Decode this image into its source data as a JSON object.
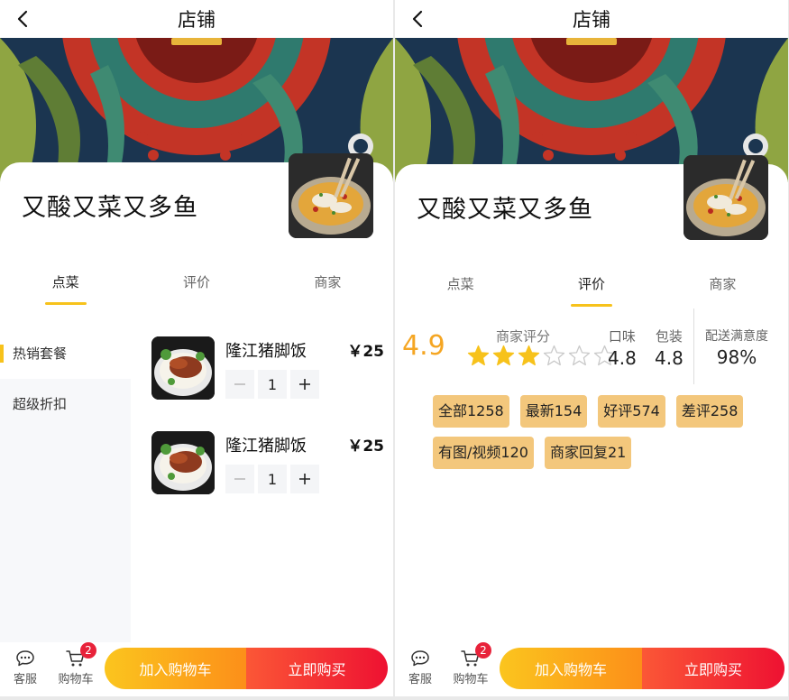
{
  "left": {
    "nav": {
      "title": "店铺"
    },
    "shop": {
      "name": "又酸又菜又多鱼"
    },
    "tabs": [
      {
        "label": "点菜",
        "active": true
      },
      {
        "label": "评价",
        "active": false
      },
      {
        "label": "商家",
        "active": false
      }
    ],
    "categories": [
      {
        "label": "热销套餐",
        "active": true
      },
      {
        "label": "超级折扣",
        "active": false
      }
    ],
    "dishes": [
      {
        "name": "隆江猪脚饭",
        "price": "￥25",
        "quantity": "1"
      },
      {
        "name": "隆江猪脚饭",
        "price": "￥25",
        "quantity": "1"
      }
    ],
    "bottom": {
      "service_label": "客服",
      "cart_label": "购物车",
      "cart_badge": "2",
      "add_to_cart": "加入购物车",
      "buy_now": "立即购买"
    }
  },
  "right": {
    "nav": {
      "title": "店铺"
    },
    "shop": {
      "name": "又酸又菜又多鱼"
    },
    "tabs": [
      {
        "label": "点菜",
        "active": false
      },
      {
        "label": "评价",
        "active": true
      },
      {
        "label": "商家",
        "active": false
      }
    ],
    "rating": {
      "score": "4.9",
      "title": "商家评分",
      "stars_filled": 3,
      "stars_total": 6,
      "taste_label": "口味",
      "taste_value": "4.8",
      "packaging_label": "包装",
      "packaging_value": "4.8",
      "delivery_label": "配送满意度",
      "delivery_value": "98%"
    },
    "filters": [
      "全部1258",
      "最新154",
      "好评574",
      "差评258",
      "有图/视频120",
      "商家回复21"
    ],
    "bottom": {
      "service_label": "客服",
      "cart_label": "购物车",
      "cart_badge": "2",
      "add_to_cart": "加入购物车",
      "buy_now": "立即购买"
    }
  },
  "colors": {
    "accent": "#f7c21b",
    "score": "#f5a623",
    "star": "#f7c21b",
    "tag_bg": "#f3c77c",
    "badge": "#e8223a"
  },
  "icons": [
    "back-arrow-icon",
    "chat-bubble-icon",
    "cart-icon",
    "star-icon",
    "plus-icon",
    "minus-icon"
  ]
}
